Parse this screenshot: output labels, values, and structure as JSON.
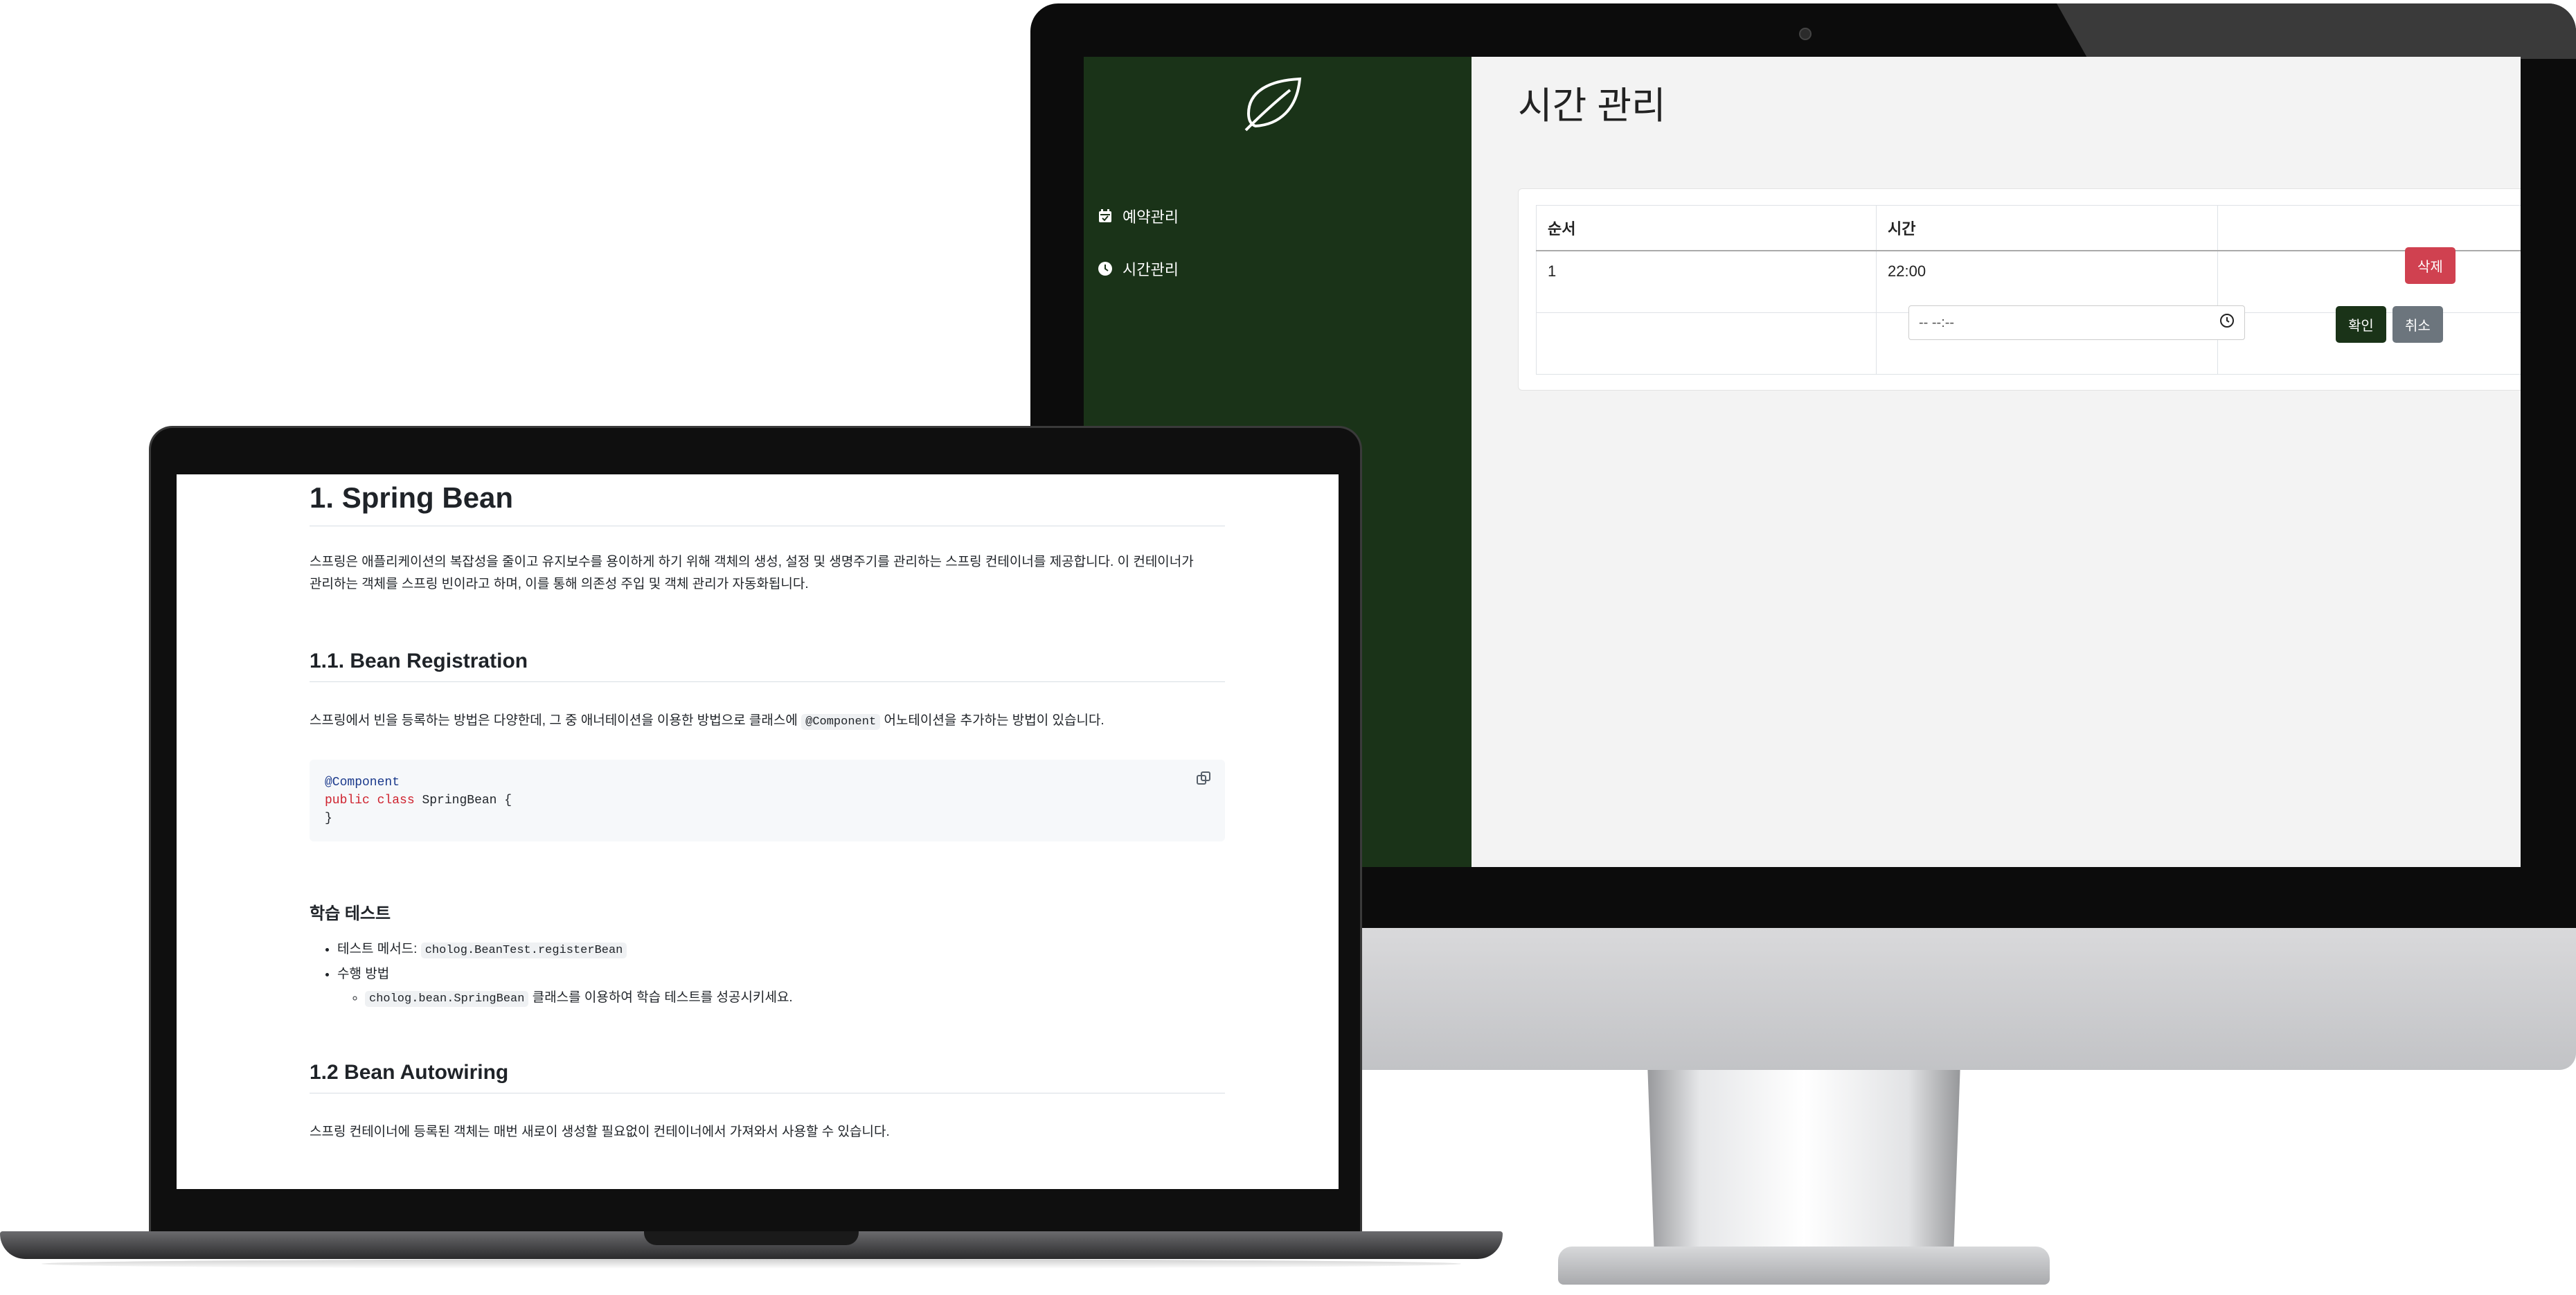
{
  "admin": {
    "nav": [
      {
        "label": "예약관리",
        "icon": "calendar-icon"
      },
      {
        "label": "시간관리",
        "icon": "clock-icon"
      }
    ],
    "logo_icon": "leaf-icon",
    "title": "시간 관리",
    "table": {
      "headers": [
        "순서",
        "시간",
        ""
      ],
      "rows": [
        {
          "order": "1",
          "time": "22:00",
          "action": "삭제"
        }
      ],
      "new_row": {
        "time_placeholder": "-- --:--",
        "confirm": "확인",
        "cancel": "취소"
      }
    },
    "colors": {
      "sidebar": "#1a3318",
      "delete": "#d04150",
      "confirm": "#1a3318",
      "cancel": "#6c757d"
    }
  },
  "doc": {
    "h1": "1. Spring Bean",
    "intro_line1": "스프링은 애플리케이션의 복잡성을 줄이고 유지보수를 용이하게 하기 위해 객체의 생성, 설정 및 생명주기를 관리하는 스프링 컨테이너를 제공합니다. 이 컨테이너가",
    "intro_line2": "관리하는 객체를 스프링 빈이라고 하며, 이를 통해 의존성 주입 및 객체 관리가 자동화됩니다.",
    "h2_registration": "1.1. Bean Registration",
    "reg_text_before": "스프링에서 빈을 등록하는 방법은 다양한데, 그 중 애너테이션을 이용한 방법으로 클래스에",
    "reg_code": "@Component",
    "reg_text_after": "어노테이션을 추가하는 방법이 있습니다.",
    "code": {
      "annotation": "@Component",
      "kw_public": "public",
      "kw_class": "class",
      "class_rest": "SpringBean {",
      "close": "}"
    },
    "h3_test": "학습 테스트",
    "test_method_label": "테스트 메서드:",
    "test_method_code": "cholog.BeanTest.registerBean",
    "how_label": "수행 방법",
    "how_code": "cholog.bean.SpringBean",
    "how_text": "클래스를 이용하여 학습 테스트를 성공시키세요.",
    "h2_autowiring": "1.2 Bean Autowiring",
    "autowiring_text": "스프링 컨테이너에 등록된 객체는 매번 새로이 생성할 필요없이 컨테이너에서 가져와서 사용할 수 있습니다."
  }
}
